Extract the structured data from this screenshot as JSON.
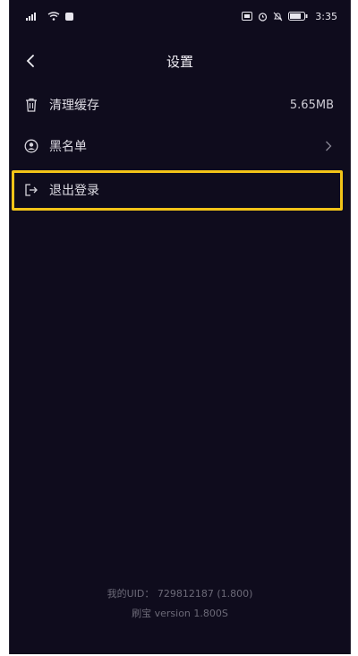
{
  "status_bar": {
    "time": "3:35",
    "battery_text": "▮▮▮▯"
  },
  "header": {
    "title": "设置"
  },
  "settings": {
    "clear_cache": {
      "label": "清理缓存",
      "value": "5.65MB",
      "icon": "trash-icon"
    },
    "blacklist": {
      "label": "黑名单",
      "icon": "user-circle-icon"
    },
    "logout": {
      "label": "退出登录",
      "icon": "logout-icon"
    }
  },
  "footer": {
    "uid_label": "我的UID：",
    "uid_value": "729812187 (1.800)",
    "version_text": "刷宝 version 1.800S"
  },
  "colors": {
    "background": "#0f0c1d",
    "highlight": "#f2c418"
  }
}
